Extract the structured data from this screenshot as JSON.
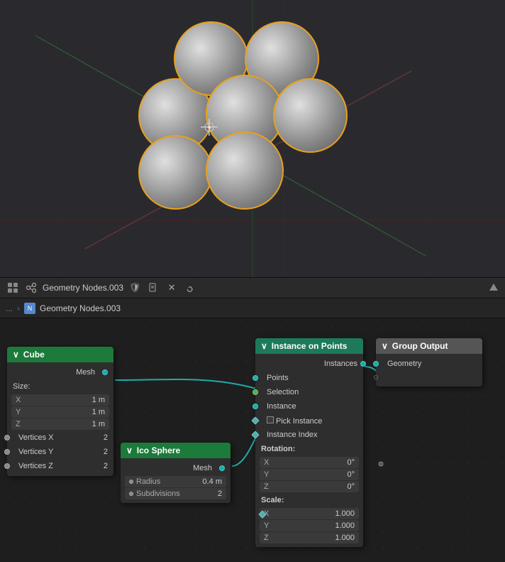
{
  "viewport": {
    "label": "3D Viewport"
  },
  "toolbar": {
    "editor_type_icon": "⬛",
    "filename": "Geometry Nodes.003",
    "pin_icon": "📌",
    "new_icon": "📄",
    "close_icon": "✕",
    "link_icon": "🔗",
    "scroll_icon": "⬆"
  },
  "breadcrumb": {
    "back_label": "...",
    "arrow": ">",
    "icon_label": "N",
    "name": "Geometry Nodes.003"
  },
  "nodes": {
    "cube": {
      "title": "Cube",
      "header_arrow": "∨",
      "output_label": "Mesh",
      "size_label": "Size:",
      "x_label": "X",
      "x_value": "1 m",
      "y_label": "Y",
      "y_value": "1 m",
      "z_label": "Z",
      "z_value": "1 m",
      "vertices_x_label": "Vertices X",
      "vertices_x_value": "2",
      "vertices_y_label": "Vertices Y",
      "vertices_y_value": "2",
      "vertices_z_label": "Vertices Z",
      "vertices_z_value": "2"
    },
    "ico_sphere": {
      "title": "Ico Sphere",
      "header_arrow": "∨",
      "output_label": "Mesh",
      "radius_label": "Radius",
      "radius_value": "0.4 m",
      "subdivisions_label": "Subdivisions",
      "subdivisions_value": "2"
    },
    "instance_on_points": {
      "title": "Instance on Points",
      "header_arrow": "∨",
      "geometry_in_label": "Instances",
      "points_label": "Points",
      "selection_label": "Selection",
      "instance_label": "Instance",
      "pick_instance_label": "Pick Instance",
      "instance_index_label": "Instance Index",
      "rotation_label": "Rotation:",
      "rot_x_label": "X",
      "rot_x_value": "0°",
      "rot_y_label": "Y",
      "rot_y_value": "0°",
      "rot_z_label": "Z",
      "rot_z_value": "0°",
      "scale_label": "Scale:",
      "scale_x_label": "X",
      "scale_x_value": "1.000",
      "scale_y_label": "Y",
      "scale_y_value": "1.000",
      "scale_z_label": "Z",
      "scale_z_value": "1.000"
    },
    "group_output": {
      "title": "Group Output",
      "header_arrow": "∨",
      "geometry_label": "Geometry"
    }
  }
}
